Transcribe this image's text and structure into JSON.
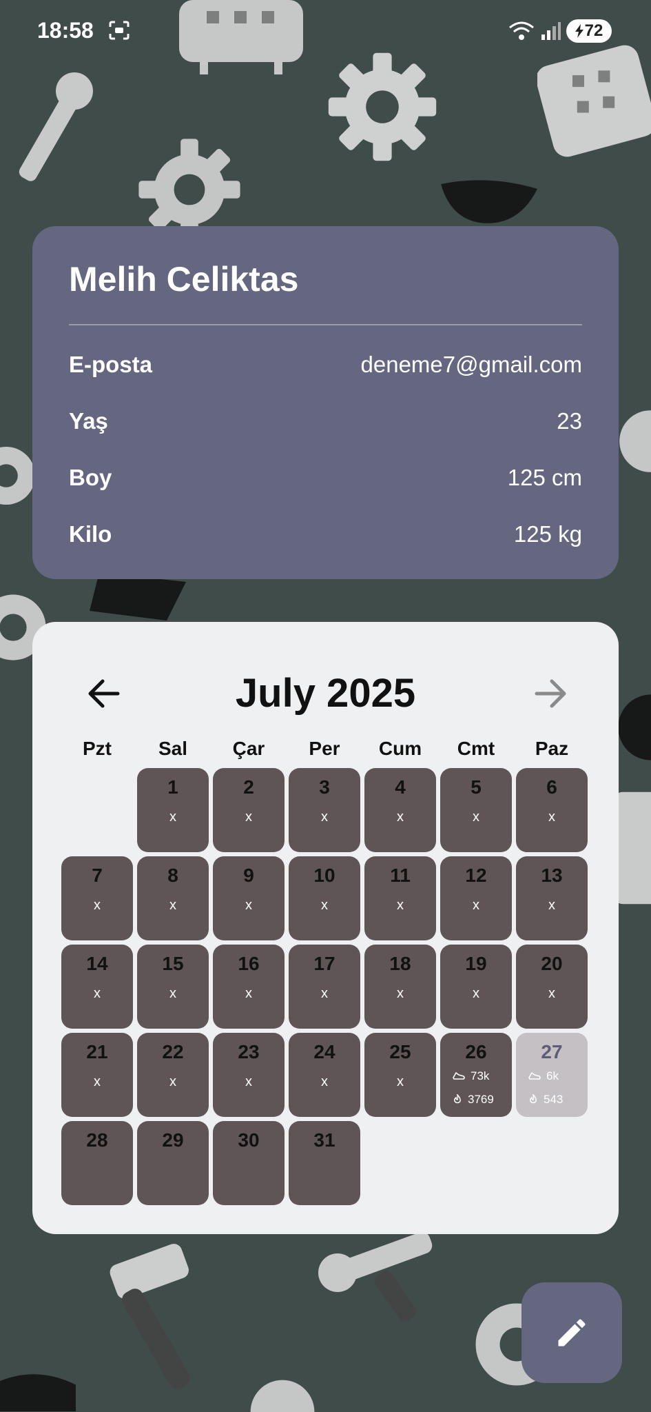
{
  "status_bar": {
    "time": "18:58",
    "battery": "72",
    "icons": [
      "screenshot-icon",
      "wifi-icon",
      "signal-icon",
      "battery-charging-icon"
    ]
  },
  "profile": {
    "name": "Melih Celiktas",
    "rows": [
      {
        "label": "E-posta",
        "value": "deneme7@gmail.com"
      },
      {
        "label": "Yaş",
        "value": "23"
      },
      {
        "label": "Boy",
        "value": "125 cm"
      },
      {
        "label": "Kilo",
        "value": "125 kg"
      }
    ]
  },
  "calendar": {
    "title": "July 2025",
    "weekdays": [
      "Pzt",
      "Sal",
      "Çar",
      "Per",
      "Cum",
      "Cmt",
      "Paz"
    ],
    "colors": {
      "day": "#5f5556",
      "today": "#c4c0c3",
      "card": "#eff0f2"
    },
    "days": [
      {
        "num": "1",
        "mark": "x"
      },
      {
        "num": "2",
        "mark": "x"
      },
      {
        "num": "3",
        "mark": "x"
      },
      {
        "num": "4",
        "mark": "x"
      },
      {
        "num": "5",
        "mark": "x"
      },
      {
        "num": "6",
        "mark": "x"
      },
      {
        "num": "7",
        "mark": "x"
      },
      {
        "num": "8",
        "mark": "x"
      },
      {
        "num": "9",
        "mark": "x"
      },
      {
        "num": "10",
        "mark": "x"
      },
      {
        "num": "11",
        "mark": "x"
      },
      {
        "num": "12",
        "mark": "x"
      },
      {
        "num": "13",
        "mark": "x"
      },
      {
        "num": "14",
        "mark": "x"
      },
      {
        "num": "15",
        "mark": "x"
      },
      {
        "num": "16",
        "mark": "x"
      },
      {
        "num": "17",
        "mark": "x"
      },
      {
        "num": "18",
        "mark": "x"
      },
      {
        "num": "19",
        "mark": "x"
      },
      {
        "num": "20",
        "mark": "x"
      },
      {
        "num": "21",
        "mark": "x"
      },
      {
        "num": "22",
        "mark": "x"
      },
      {
        "num": "23",
        "mark": "x"
      },
      {
        "num": "24",
        "mark": "x"
      },
      {
        "num": "25",
        "mark": "x"
      },
      {
        "num": "26",
        "steps": "73k",
        "calories": "3769"
      },
      {
        "num": "27",
        "steps": "6k",
        "calories": "543",
        "today": true
      },
      {
        "num": "28"
      },
      {
        "num": "29"
      },
      {
        "num": "30"
      },
      {
        "num": "31"
      }
    ]
  },
  "fab": {
    "icon": "pencil-icon"
  }
}
